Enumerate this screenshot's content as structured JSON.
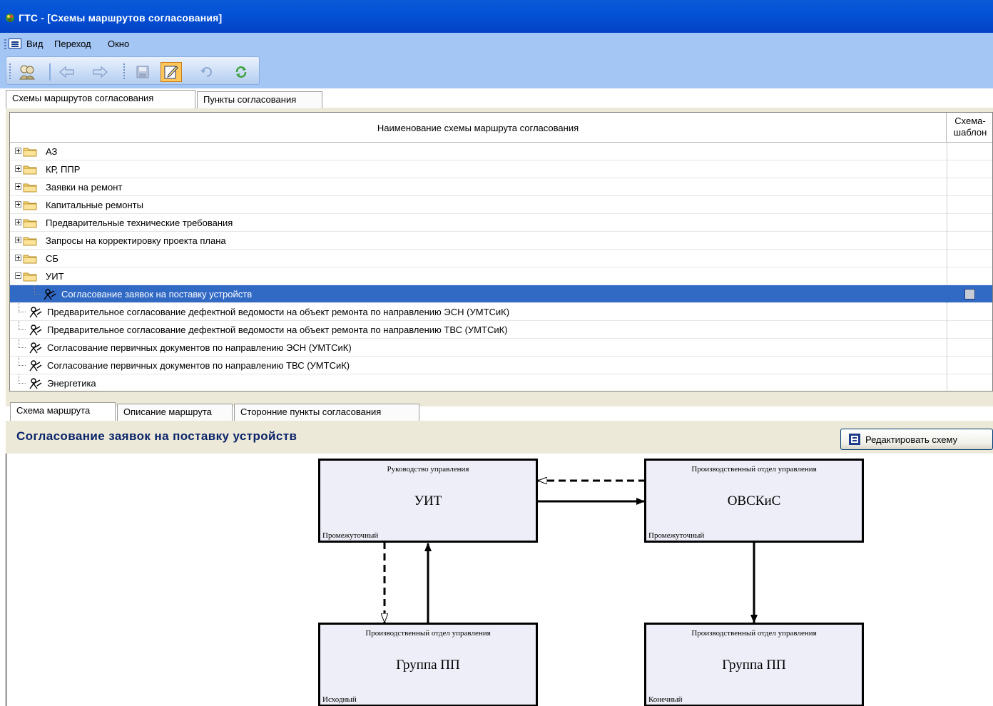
{
  "window": {
    "title": "ГТС - [Схемы маршрутов согласования]"
  },
  "menu": {
    "items": [
      "Вид",
      "Переход",
      "Окно"
    ]
  },
  "toolbar": {
    "buttons": [
      "search-people-icon",
      "back-arrow-icon",
      "forward-arrow-icon",
      "save-icon",
      "edit-icon",
      "undo-icon",
      "refresh-icon"
    ],
    "active_button": "edit-icon"
  },
  "main_tabs": [
    "Схемы маршрутов согласования",
    "Пункты согласования"
  ],
  "grid": {
    "columns": [
      "Наименование схемы маршрута согласования",
      "Схема-\nшаблон"
    ],
    "rows": [
      {
        "type": "folder",
        "label": "АЗ",
        "expanded": false
      },
      {
        "type": "folder",
        "label": "КР, ППР",
        "expanded": false
      },
      {
        "type": "folder",
        "label": "Заявки на ремонт",
        "expanded": false
      },
      {
        "type": "folder",
        "label": "Капитальные ремонты",
        "expanded": false
      },
      {
        "type": "folder",
        "label": "Предварительные технические требования",
        "expanded": false
      },
      {
        "type": "folder",
        "label": "Запросы на корректировку проекта плана",
        "expanded": false
      },
      {
        "type": "folder",
        "label": "СБ",
        "expanded": false
      },
      {
        "type": "folder",
        "label": "УИТ",
        "expanded": true
      },
      {
        "type": "route",
        "label": "Согласование заявок на поставку устройств",
        "selected": true,
        "template": false
      },
      {
        "type": "route",
        "label": "Предварительное согласование дефектной ведомости на объект ремонта по направлению ЭСН (УМТСиК)"
      },
      {
        "type": "route",
        "label": "Предварительное согласование дефектной ведомости на объект ремонта по направлению ТВС (УМТСиК)"
      },
      {
        "type": "route",
        "label": "Согласование первичных документов по направлению ЭСН (УМТСиК)"
      },
      {
        "type": "route",
        "label": "Согласование первичных документов по направлению ТВС (УМТСиК)"
      },
      {
        "type": "route",
        "label": "Энергетика"
      }
    ]
  },
  "detail_tabs": [
    "Схема маршрута",
    "Описание маршрута",
    "Сторонние пункты согласования"
  ],
  "detail": {
    "title": "Согласование заявок на поставку устройств",
    "edit_button": "Редактировать схему"
  },
  "diagram": {
    "nodes": [
      {
        "dept": "Руководство управления",
        "name": "УИТ",
        "kind": "Промежуточный"
      },
      {
        "dept": "Производственный отдел управления",
        "name": "ОВСКиС",
        "kind": "Промежуточный"
      },
      {
        "dept": "Производственный отдел управления",
        "name": "Группа ПП",
        "kind": "Исходный"
      },
      {
        "dept": "Производственный отдел управления",
        "name": "Группа ПП",
        "kind": "Конечный"
      }
    ],
    "edges": [
      {
        "from": "УИТ",
        "to": "ОВСКиС",
        "style": "solid"
      },
      {
        "from": "ОВСКиС",
        "to": "УИТ",
        "style": "dashed"
      },
      {
        "from": "Группа ПП (Исходный)",
        "to": "УИТ",
        "style": "solid"
      },
      {
        "from": "УИТ",
        "to": "Группа ПП (Исходный)",
        "style": "dashed"
      },
      {
        "from": "ОВСКиС",
        "to": "Группа ПП (Конечный)",
        "style": "solid"
      }
    ]
  },
  "colors": {
    "titlebar": "#0451d6",
    "menubar": "#a4c6f4",
    "selection": "#316ac5",
    "detail_title": "#0a246a",
    "node_fill": "#eeeef8"
  }
}
